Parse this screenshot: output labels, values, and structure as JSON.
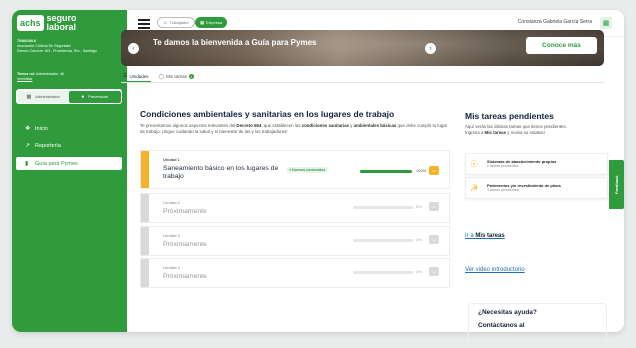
{
  "brand": {
    "badge": "achs",
    "line1": "seguro",
    "line2": "laboral"
  },
  "org": {
    "id": "70360100-6",
    "name": "Asociación Chilena De Seguridad",
    "address": "Ramon Carnicer 163 , Providencia, Rm - Santiago"
  },
  "role": {
    "label": "Tienes rol:",
    "value": "Administrador, 46",
    "extra": "Ver/editar"
  },
  "profile_toggle": {
    "admin": "Administrador",
    "prev": "Prevención"
  },
  "sidebar": {
    "items": [
      {
        "label": "Inicio",
        "icon": "home-icon"
      },
      {
        "label": "Reportería",
        "icon": "chart-icon"
      },
      {
        "label": "Guía para Pymes",
        "icon": "book-icon",
        "active": true
      }
    ]
  },
  "topbar": {
    "trabajador": "Trabajador",
    "empresa": "Empresa",
    "user_name": "Constanza Gabriela García Serra"
  },
  "banner": {
    "title": "Te damos la bienvenida a Guía para Pymes",
    "cta": "Conoce más"
  },
  "tabs": [
    {
      "label": "Unidades",
      "active": true
    },
    {
      "label": "Mis tareas",
      "badge": "2"
    }
  ],
  "main": {
    "title": "Condiciones ambientales y sanitarias en los lugares de trabajo",
    "desc_1": "Te presentamos algunos aspectos relevantes del",
    "desc_b1": "Decreto 594",
    "desc_2": ", que establecen las",
    "desc_b2": "condiciones sanitarias",
    "desc_3": "y",
    "desc_b3": "ambientales básicas",
    "desc_4": "que debe cumplir tu lugar de trabajo. ¡Sigue cuidando la salud y el bienestar de las y los trabajadores!"
  },
  "units": [
    {
      "label": "Unidad 1",
      "title": "Saneamiento básico en los lugares de trabajo",
      "badge": "● Nuevos contenidos",
      "progress": 100,
      "pct_text": "100%"
    },
    {
      "label": "Unidad 2",
      "title": "Próximamente",
      "progress": 0,
      "pct_text": "0%"
    },
    {
      "label": "Unidad 3",
      "title": "Próximamente",
      "progress": 0,
      "pct_text": "0%"
    },
    {
      "label": "Unidad 4",
      "title": "Próximamente",
      "progress": 0,
      "pct_text": "0%"
    }
  ],
  "pending": {
    "title": "Mis tareas pendientes",
    "desc_1": "Aquí verás las últimas tareas que tienes pendientes.",
    "desc_2": "Ingresa a",
    "desc_b": "Mis tareas",
    "desc_3": "y revisa su estatus!",
    "tasks": [
      {
        "title": "Sistemas de abastecimiento propios",
        "sub": "2 tareas pendientes"
      },
      {
        "title": "Pavimentos y/o revestimiento de pisos",
        "sub": "3 tareas pendientes"
      }
    ],
    "goto_prefix": "Ir a",
    "goto_link": "Mis tareas",
    "video_link": "Ver video introductorio"
  },
  "help": {
    "line1": "¿Necesitas ayuda?",
    "line2": "Contáctanos al"
  },
  "feedback": "Feedback",
  "colors": {
    "brand": "#2f9b3c",
    "accent": "#f6b32a",
    "link": "#1d6fb8"
  }
}
